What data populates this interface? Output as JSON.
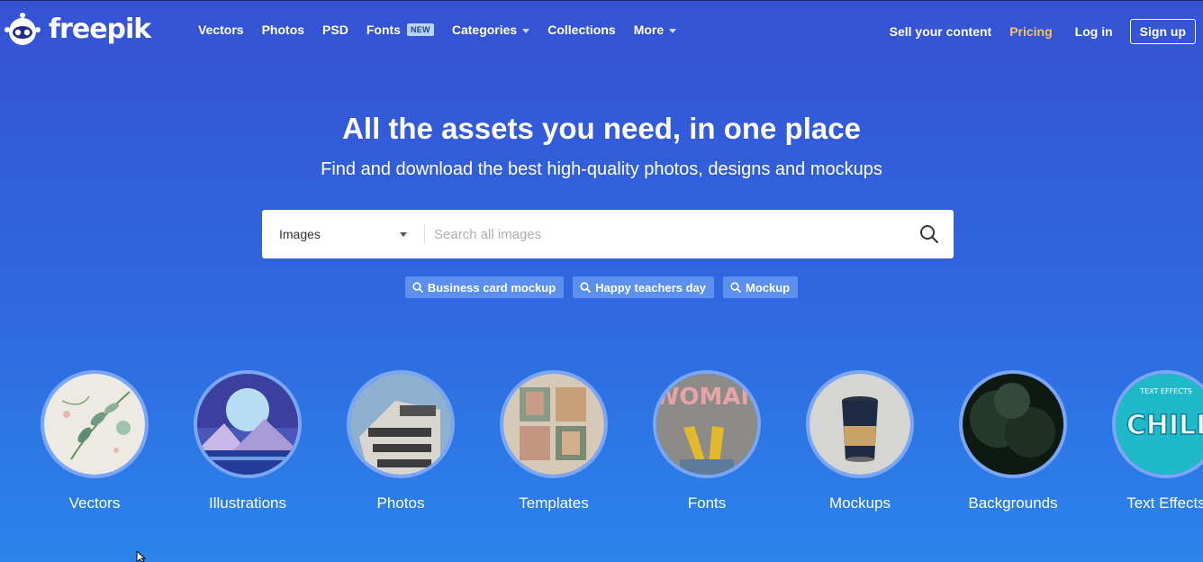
{
  "brand": {
    "name": "freepik"
  },
  "nav": {
    "items": [
      {
        "label": "Vectors"
      },
      {
        "label": "Photos"
      },
      {
        "label": "PSD"
      },
      {
        "label": "Fonts",
        "badge": "NEW"
      },
      {
        "label": "Categories",
        "dropdown": true
      },
      {
        "label": "Collections"
      },
      {
        "label": "More",
        "dropdown": true
      }
    ],
    "right": {
      "sell": "Sell your content",
      "pricing": "Pricing",
      "login": "Log in",
      "signup": "Sign up"
    }
  },
  "hero": {
    "title": "All the assets you need, in one place",
    "subtitle": "Find and download the best high-quality photos, designs and mockups"
  },
  "search": {
    "type_selected": "Images",
    "placeholder": "Search all images"
  },
  "suggestions": [
    {
      "label": "Business card mockup"
    },
    {
      "label": "Happy teachers day"
    },
    {
      "label": "Mockup"
    }
  ],
  "categories": [
    {
      "label": "Vectors"
    },
    {
      "label": "Illustrations"
    },
    {
      "label": "Photos"
    },
    {
      "label": "Templates"
    },
    {
      "label": "Fonts",
      "image_text": "WOMAN"
    },
    {
      "label": "Mockups"
    },
    {
      "label": "Backgrounds"
    },
    {
      "label": "Text Effects",
      "image_text": "CHILL",
      "image_caption": "TEXT EFFECTS"
    }
  ],
  "colors": {
    "pricing": "#f5c26b",
    "tag_bg": "#5c90ee",
    "circle_border": "#7aa6f3"
  }
}
